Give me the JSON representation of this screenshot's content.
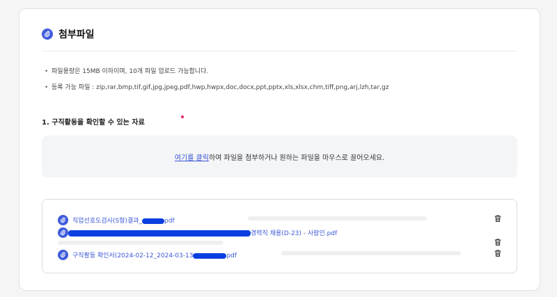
{
  "section": {
    "title": "첨부파일"
  },
  "notes": [
    "파일용량은 15MB 이하이며, 10개 파일 업로드 가능합니다.",
    "등록 가능 파일 : zip,rar,bmp,tif,gif,jpg,jpeg,pdf,hwp,hwpx,doc,docx,ppt,pptx,xls,xlsx,chm,tiff,png,arj,lzh,tar,gz"
  ],
  "requirement": {
    "label": "1. 구직활동을 확인할 수 있는 자료"
  },
  "dropzone": {
    "link_text": "여기를 클릭",
    "rest_text": "하여 파일을 첨부하거나 원하는 파일을 마우스로 끌어오세요."
  },
  "files": [
    {
      "name_start": "직업선호도검사(S형)결과_",
      "name_end": "pdf"
    },
    {
      "name_start": "",
      "name_end": "경력직 채용(D-23) - 사람인.pdf"
    },
    {
      "name_start": "구직활동 확인서(2024-02-12_2024-03-13",
      "name_end": "pdf"
    }
  ],
  "colors": {
    "accent": "#3f5bdc",
    "redaction": "#0b3fe0",
    "required_dot": "#e0245e"
  }
}
